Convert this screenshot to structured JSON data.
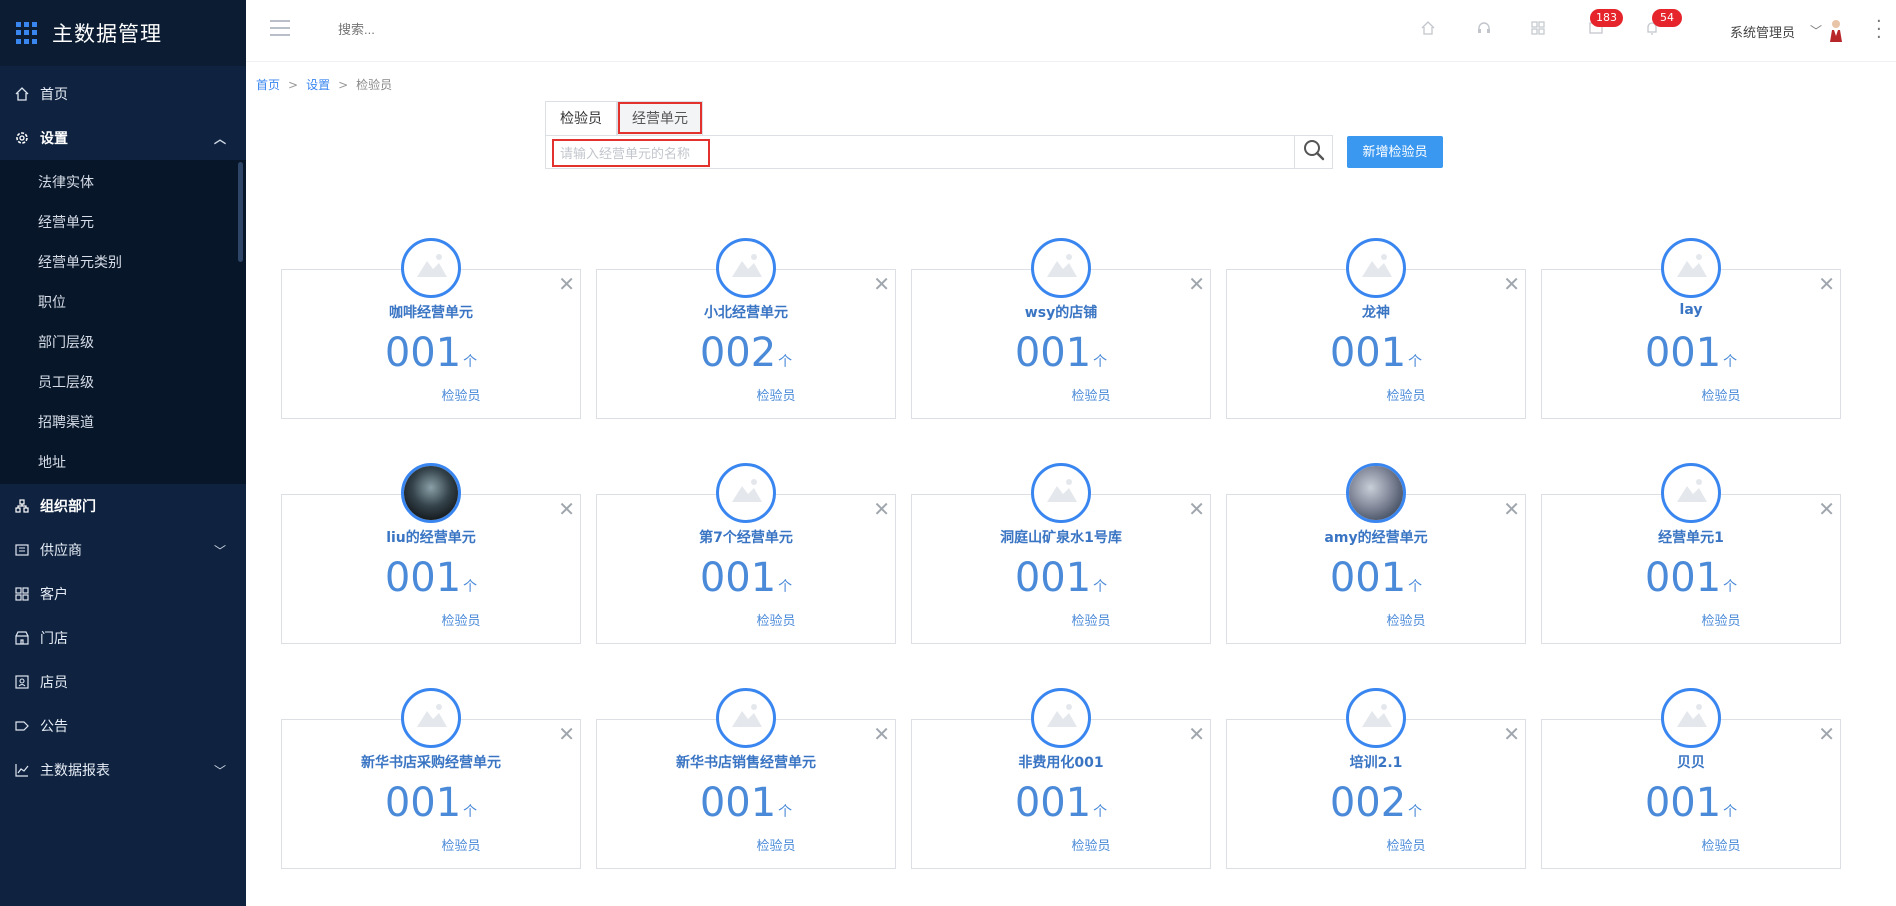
{
  "app": {
    "title": "主数据管理"
  },
  "sidebar": {
    "items": [
      {
        "label": "首页",
        "icon": "home-icon"
      },
      {
        "label": "设置",
        "icon": "gear-icon",
        "expanded": true,
        "children": [
          "法律实体",
          "经营单元",
          "经营单元类别",
          "职位",
          "部门层级",
          "员工层级",
          "招聘渠道",
          "地址"
        ]
      },
      {
        "label": "组织部门",
        "icon": "org-icon"
      },
      {
        "label": "供应商",
        "icon": "supplier-icon",
        "caret": true
      },
      {
        "label": "客户",
        "icon": "customer-icon"
      },
      {
        "label": "门店",
        "icon": "store-icon"
      },
      {
        "label": "店员",
        "icon": "clerk-icon"
      },
      {
        "label": "公告",
        "icon": "announcement-icon"
      },
      {
        "label": "主数据报表",
        "icon": "chart-icon",
        "caret": true
      }
    ]
  },
  "header": {
    "search_placeholder": "搜索...",
    "badges": {
      "messages": "183",
      "notifications": "54"
    },
    "user_name": "系统管理员"
  },
  "breadcrumb": {
    "home": "首页",
    "settings": "设置",
    "current": "检验员"
  },
  "tabs": [
    {
      "label": "检验员",
      "selected": false
    },
    {
      "label": "经营单元",
      "selected": true
    }
  ],
  "search": {
    "placeholder": "请输入经营单元的名称"
  },
  "add_button": "新增检验员",
  "cards": [
    {
      "name": "咖啡经营单元",
      "count": "001",
      "unit": "个",
      "role": "检验员",
      "avatar": "placeholder"
    },
    {
      "name": "小北经营单元",
      "count": "002",
      "unit": "个",
      "role": "检验员",
      "avatar": "placeholder"
    },
    {
      "name": "wsy的店铺",
      "count": "001",
      "unit": "个",
      "role": "检验员",
      "avatar": "placeholder"
    },
    {
      "name": "龙神",
      "count": "001",
      "unit": "个",
      "role": "检验员",
      "avatar": "placeholder"
    },
    {
      "name": "lay",
      "count": "001",
      "unit": "个",
      "role": "检验员",
      "avatar": "placeholder"
    },
    {
      "name": "liu的经营单元",
      "count": "001",
      "unit": "个",
      "role": "检验员",
      "avatar": "photo1"
    },
    {
      "name": "第7个经营单元",
      "count": "001",
      "unit": "个",
      "role": "检验员",
      "avatar": "placeholder"
    },
    {
      "name": "洞庭山矿泉水1号库",
      "count": "001",
      "unit": "个",
      "role": "检验员",
      "avatar": "placeholder"
    },
    {
      "name": "amy的经营单元",
      "count": "001",
      "unit": "个",
      "role": "检验员",
      "avatar": "photo2"
    },
    {
      "name": "经营单元1",
      "count": "001",
      "unit": "个",
      "role": "检验员",
      "avatar": "placeholder"
    },
    {
      "name": "新华书店采购经营单元",
      "count": "001",
      "unit": "个",
      "role": "检验员",
      "avatar": "placeholder"
    },
    {
      "name": "新华书店销售经营单元",
      "count": "001",
      "unit": "个",
      "role": "检验员",
      "avatar": "placeholder"
    },
    {
      "name": "非费用化001",
      "count": "001",
      "unit": "个",
      "role": "检验员",
      "avatar": "placeholder"
    },
    {
      "name": "培训2.1",
      "count": "002",
      "unit": "个",
      "role": "检验员",
      "avatar": "placeholder"
    },
    {
      "name": "贝贝",
      "count": "001",
      "unit": "个",
      "role": "检验员",
      "avatar": "placeholder"
    }
  ],
  "colors": {
    "sidebar_bg": "#0f2340",
    "accent": "#3a86f0",
    "highlight": "#e3312d",
    "badge": "#e5242b"
  }
}
